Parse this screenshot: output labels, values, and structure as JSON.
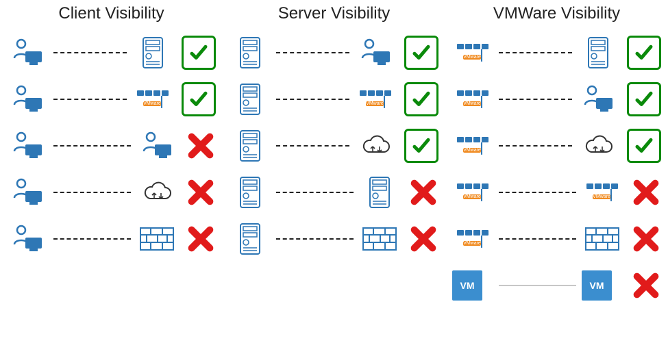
{
  "columns": [
    {
      "title": "Client Visibility",
      "rows": [
        {
          "left": "client",
          "right": "server",
          "status": "check"
        },
        {
          "left": "client",
          "right": "vmware",
          "status": "check"
        },
        {
          "left": "client",
          "right": "client",
          "status": "cross"
        },
        {
          "left": "client",
          "right": "cloud",
          "status": "cross"
        },
        {
          "left": "client",
          "right": "firewall",
          "status": "cross"
        }
      ]
    },
    {
      "title": "Server Visibility",
      "rows": [
        {
          "left": "server",
          "right": "client",
          "status": "check"
        },
        {
          "left": "server",
          "right": "vmware",
          "status": "check"
        },
        {
          "left": "server",
          "right": "cloud",
          "status": "check"
        },
        {
          "left": "server",
          "right": "server",
          "status": "cross"
        },
        {
          "left": "server",
          "right": "firewall",
          "status": "cross"
        }
      ]
    },
    {
      "title": "VMWare Visibility",
      "rows": [
        {
          "left": "vmware",
          "right": "server",
          "status": "check"
        },
        {
          "left": "vmware",
          "right": "client",
          "status": "check"
        },
        {
          "left": "vmware",
          "right": "cloud",
          "status": "check"
        },
        {
          "left": "vmware",
          "right": "vmware",
          "status": "cross"
        },
        {
          "left": "vmware",
          "right": "firewall",
          "status": "cross"
        },
        {
          "left": "vmbox",
          "right": "vmbox",
          "status": "cross",
          "link": "grey"
        }
      ]
    }
  ],
  "labels": {
    "vmware_label": "VMware",
    "vm_label": "VM"
  }
}
